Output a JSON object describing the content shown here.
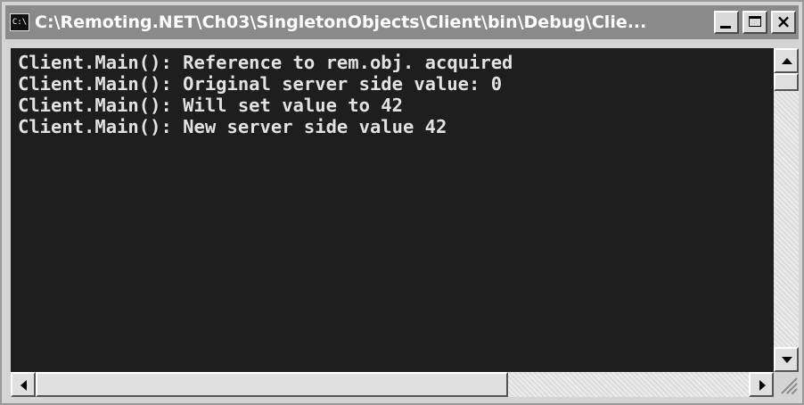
{
  "window": {
    "title": "C:\\Remoting.NET\\Ch03\\SingletonObjects\\Client\\bin\\Debug\\Clie...",
    "icon": "console-app-icon",
    "icon_text": "C:\\"
  },
  "caption_buttons": {
    "minimize_icon": "minimize-icon",
    "maximize_icon": "maximize-icon",
    "close_label": "×"
  },
  "console": {
    "lines": [
      "Client.Main(): Reference to rem.obj. acquired",
      "Client.Main(): Original server side value: 0",
      "Client.Main(): Will set value to 42",
      "Client.Main(): New server side value 42"
    ],
    "background": "#1e1e1e",
    "foreground": "#e2e2e2"
  },
  "scrollbars": {
    "vertical": {
      "position_fraction": 0.0
    },
    "horizontal": {
      "position_fraction": 0.0
    }
  }
}
